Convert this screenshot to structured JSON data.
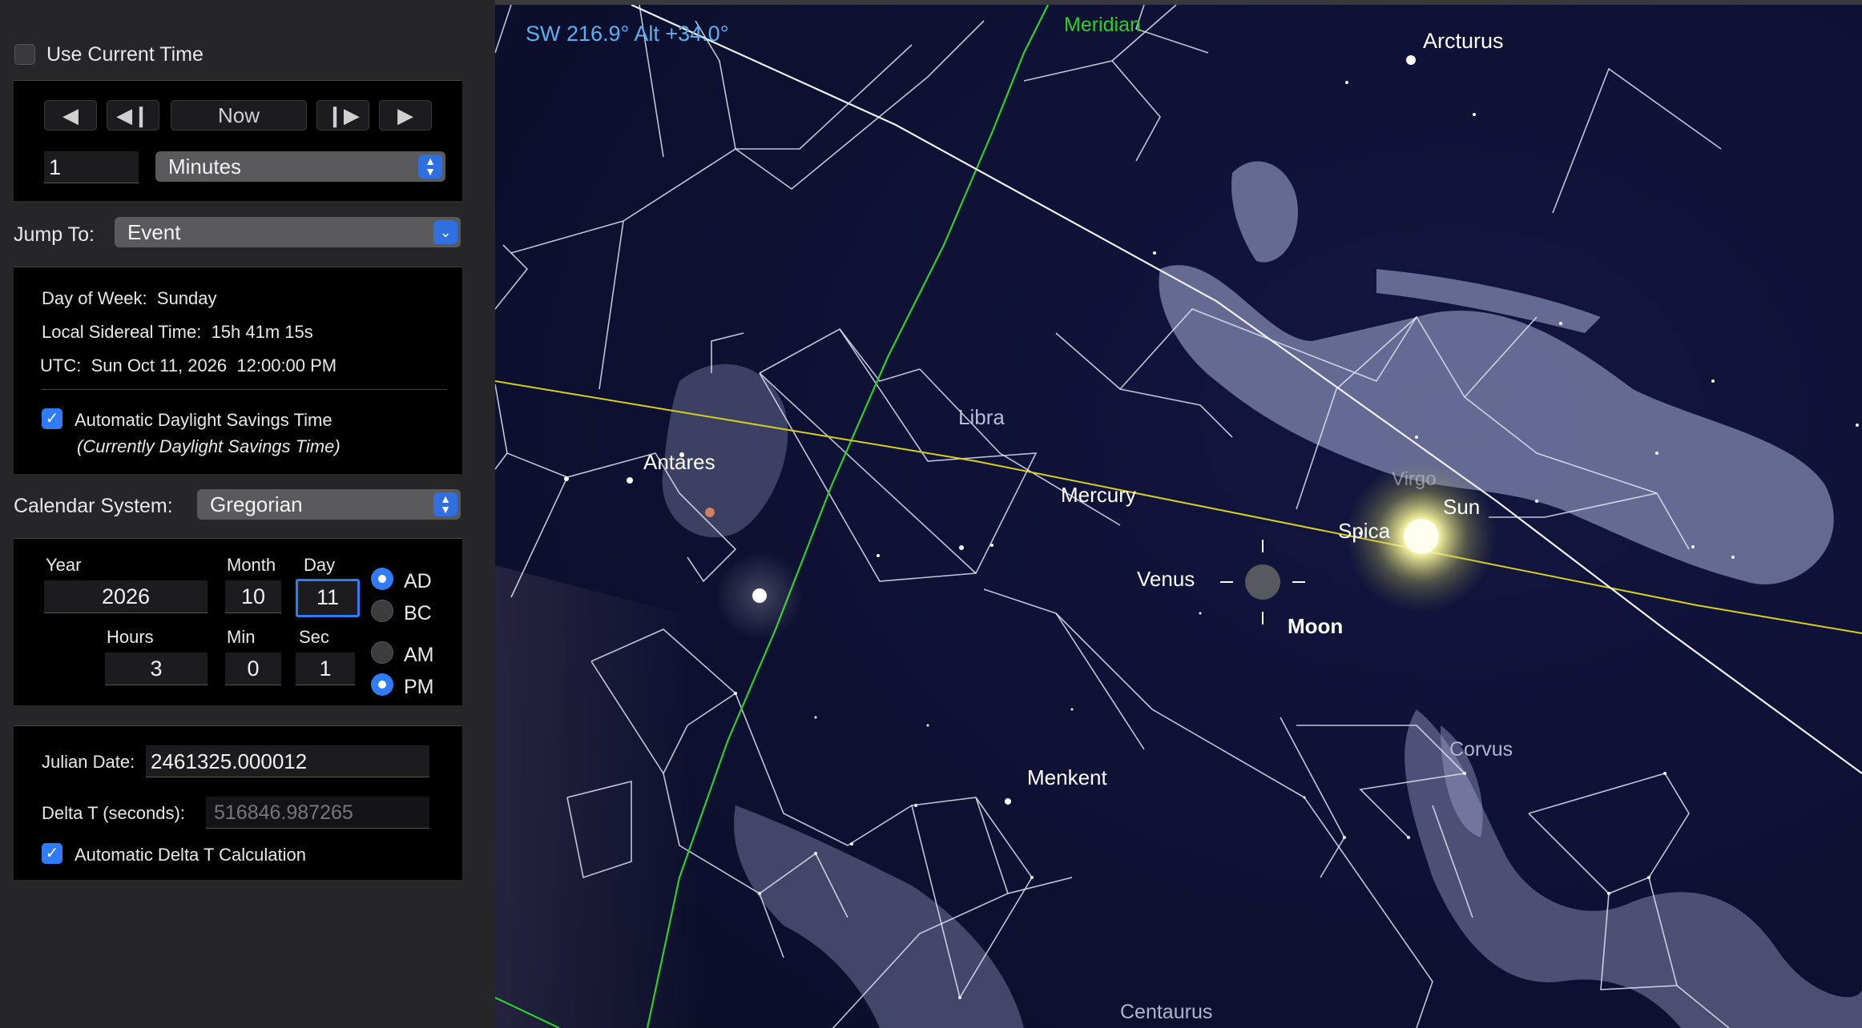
{
  "time_controls": {
    "use_current_time": "Use Current Time",
    "step_back_icon": "triangle-left-icon",
    "frame_back_icon": "step-back-icon",
    "now_label": "Now",
    "frame_forward_icon": "step-forward-icon",
    "step_forward_icon": "triangle-right-icon",
    "step_value": "1",
    "step_unit": "Minutes"
  },
  "jump_to": {
    "label": "Jump To:",
    "value": "Event"
  },
  "info": {
    "day_of_week_label": "Day of Week:",
    "day_of_week": "Sunday",
    "sidereal_label": "Local Sidereal Time:",
    "sidereal": "15h 41m 15s",
    "utc_label": "UTC:",
    "utc": "Sun Oct 11, 2026  12:00:00 PM",
    "dst_label": "Automatic Daylight Savings Time",
    "dst_note": "(Currently Daylight Savings Time)"
  },
  "calendar": {
    "label": "Calendar System:",
    "value": "Gregorian"
  },
  "date": {
    "year_label": "Year",
    "year": "2026",
    "month_label": "Month",
    "month": "10",
    "day_label": "Day",
    "day": "11",
    "hours_label": "Hours",
    "hours": "3",
    "min_label": "Min",
    "min": "0",
    "sec_label": "Sec",
    "sec": "1",
    "ad": "AD",
    "bc": "BC",
    "am": "AM",
    "pm": "PM"
  },
  "julian": {
    "jd_label": "Julian Date:",
    "jd": "2461325.000012",
    "dt_label": "Delta T (seconds):",
    "dt": "516846.987265",
    "auto_dt": "Automatic Delta T Calculation"
  },
  "sky": {
    "orientation": "SW 216.9° Alt +34.0°",
    "meridian": "Meridian",
    "labels": {
      "arcturus": "Arcturus",
      "libra": "Libra",
      "antares": "Antares",
      "virgo": "Virgo",
      "mercury": "Mercury",
      "spica": "Spica",
      "sun": "Sun",
      "venus": "Venus",
      "moon": "Moon",
      "corvus": "Corvus",
      "menkent": "Menkent",
      "centaurus": "Centaurus"
    },
    "colors": {
      "background": "#0d1030",
      "ecliptic": "#d8d020",
      "meridian": "#2bd02b",
      "orientation": "#5ab0f0"
    }
  }
}
